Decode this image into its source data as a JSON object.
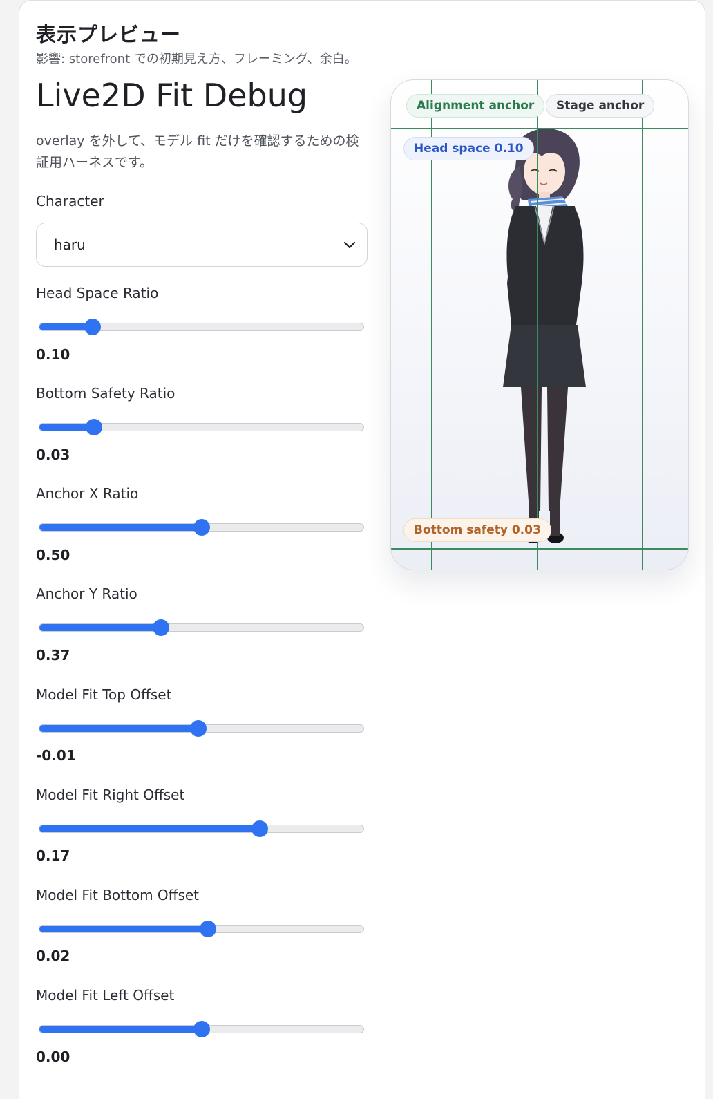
{
  "section": {
    "title": "表示プレビュー",
    "subtitle": "影響: storefront での初期見え方、フレーミング、余白。"
  },
  "page_title": "Live2D Fit Debug",
  "description": "overlay を外して、モデル fit だけを確認するための検証用ハーネスです。",
  "character": {
    "label": "Character",
    "selected": "haru"
  },
  "sliders": [
    {
      "label": "Head Space Ratio",
      "value": "0.10",
      "fill": 0.165
    },
    {
      "label": "Bottom Safety Ratio",
      "value": "0.03",
      "fill": 0.17
    },
    {
      "label": "Anchor X Ratio",
      "value": "0.50",
      "fill": 0.5
    },
    {
      "label": "Anchor Y Ratio",
      "value": "0.37",
      "fill": 0.375
    },
    {
      "label": "Model Fit Top Offset",
      "value": "-0.01",
      "fill": 0.49
    },
    {
      "label": "Model Fit Right Offset",
      "value": "0.17",
      "fill": 0.68
    },
    {
      "label": "Model Fit Bottom Offset",
      "value": "0.02",
      "fill": 0.52
    },
    {
      "label": "Model Fit Left Offset",
      "value": "0.00",
      "fill": 0.5
    }
  ],
  "preview": {
    "alignment_chip": "Alignment anchor",
    "stage_chip": "Stage anchor",
    "head_chip": "Head space 0.10",
    "bottom_chip": "Bottom safety 0.03"
  },
  "colors": {
    "accent": "#2f73f2",
    "guide": "#3b8a60"
  }
}
